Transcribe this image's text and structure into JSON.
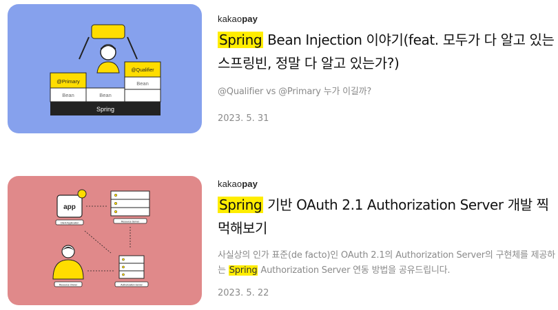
{
  "posts": [
    {
      "brand": {
        "part1": "kakao",
        "part2": "pay"
      },
      "title_highlight": "Spring",
      "title_rest": " Bean Injection 이야기(feat. 모두가 다 알고 있는 스프링빈, 정말 다 알고 있는가?)",
      "desc_before": "@Qualifier vs @Primary 누가 이길까?",
      "desc_highlight": "",
      "desc_after": "",
      "date": "2023. 5. 31",
      "thumb": {
        "bg": "#86a1ed",
        "labels": {
          "primary": "@Primary",
          "qualifier": "@Qualifier",
          "bean": "Bean",
          "spring": "Spring"
        }
      }
    },
    {
      "brand": {
        "part1": "kakao",
        "part2": "pay"
      },
      "title_highlight": "Spring",
      "title_rest": " 기반 OAuth 2.1 Authorization Server 개발 찍먹해보기",
      "desc_before": "사실상의 인가 표준(de facto)인 OAuth 2.1의 Authorization Server의 구현체를 제공하는 ",
      "desc_highlight": "Spring",
      "desc_after": " Authorization Server 연동 방법을 공유드립니다.",
      "date": "2023. 5. 22",
      "thumb": {
        "bg": "#e0898a",
        "labels": {
          "app": "app",
          "client": "Client Application",
          "resource_server": "Resource Server",
          "owner": "Resource Owner",
          "auth_server": "Authorization Server"
        }
      }
    }
  ],
  "colors": {
    "highlight": "#ffed00",
    "meta_text": "#8a8a8a"
  }
}
